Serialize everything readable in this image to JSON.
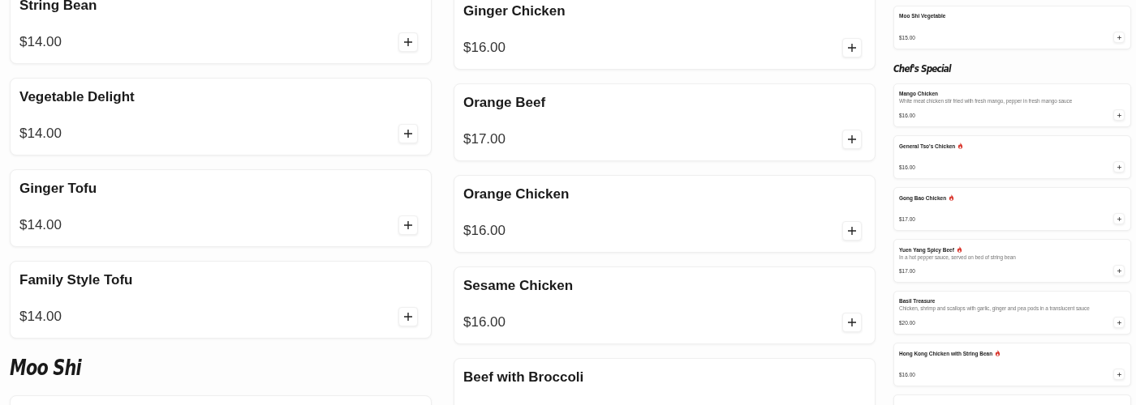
{
  "columns": [
    {
      "entries": [
        {
          "kind": "item",
          "name": "String Bean",
          "price": "$14.00"
        },
        {
          "kind": "item",
          "name": "Vegetable Delight",
          "price": "$14.00"
        },
        {
          "kind": "item",
          "name": "Ginger Tofu",
          "price": "$14.00"
        },
        {
          "kind": "item",
          "name": "Family Style Tofu",
          "price": "$14.00"
        },
        {
          "kind": "heading",
          "text": "Moo Shi"
        },
        {
          "kind": "partial"
        }
      ]
    },
    {
      "entries": [
        {
          "kind": "item",
          "name": "Ginger Chicken",
          "price": "$16.00"
        },
        {
          "kind": "item",
          "name": "Orange Beef",
          "price": "$17.00"
        },
        {
          "kind": "item",
          "name": "Orange Chicken",
          "price": "$16.00"
        },
        {
          "kind": "item",
          "name": "Sesame Chicken",
          "price": "$16.00"
        },
        {
          "kind": "item",
          "name": "Beef with Broccoli"
        }
      ]
    },
    {
      "entries": [
        {
          "kind": "item",
          "name": "Moo Shi Vegetable",
          "price": "$15.00",
          "spicy": false
        },
        {
          "kind": "heading",
          "text": "Chef's Special"
        },
        {
          "kind": "item",
          "name": "Mango Chicken",
          "description": "White meat chicken stir fried with fresh mango, pepper in fresh mango sauce",
          "price": "$16.00",
          "spicy": false
        },
        {
          "kind": "item",
          "name": "General Tso's Chicken",
          "price": "$16.00",
          "spicy": true
        },
        {
          "kind": "item",
          "name": "Gong Bao Chicken",
          "price": "$17.00",
          "spicy": true
        },
        {
          "kind": "item",
          "name": "Yuen Yang Spicy Beef",
          "description": "In a hot pepper sauce, served on bed of string bean",
          "price": "$17.00",
          "spicy": true
        },
        {
          "kind": "item",
          "name": "Basil Treasure",
          "description": "Chicken, shrimp and scallops with garlic, ginger and pea pods in a translucent sauce",
          "price": "$20.00",
          "spicy": false
        },
        {
          "kind": "item",
          "name": "Hong Kong Chicken with String Bean",
          "price": "$16.00",
          "spicy": true
        },
        {
          "kind": "partial"
        }
      ]
    }
  ]
}
